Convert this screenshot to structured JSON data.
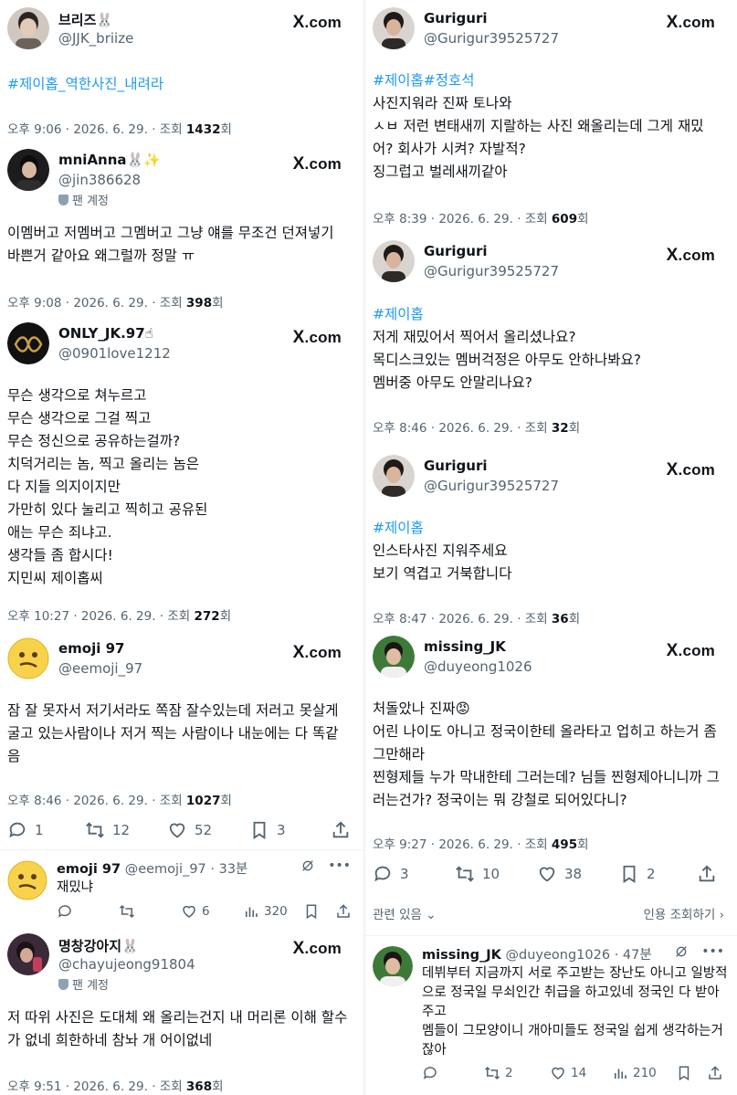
{
  "brand": {
    "x_label": "X",
    "com_label": ".com"
  },
  "left": {
    "t1": {
      "name": "브리즈🐰",
      "handle": "@JJK_briize",
      "hashtag": "#제이홉_역한사진_내려라",
      "meta_pre": "오후 9:06 · 2026. 6. 29. · 조회 ",
      "views": "1432",
      "meta_post": "회"
    },
    "t2": {
      "name": "mniAnna🐰✨",
      "handle": "@jin386628",
      "fan": "팬 계정",
      "text": "이멤버고 저멤버고 그멤버고 그냥 얘를 무조건 던져넣기 바쁜거 같아요 왜그럴까 정말 ㅠ",
      "meta_pre": "오후 9:08 · 2026. 6. 29. · 조회 ",
      "views": "398",
      "meta_post": "회"
    },
    "t3": {
      "name": "ONLY_JK.97☝",
      "handle": "@0901love1212",
      "text": "무슨 생각으로 쳐누르고\n무슨 생각으로 그걸 찍고\n무슨 정신으로 공유하는걸까?\n치덕거리는 놈, 찍고 올리는 놈은\n다 지들 의지이지만\n가만히 있다 눌리고 찍히고 공유된\n애는 무슨 죄냐고.\n생각들 좀 합시다!\n지민씨 제이홉씨",
      "meta_pre": "오후 10:27 · 2026. 6. 29. · 조회 ",
      "views": "272",
      "meta_post": "회"
    },
    "t4": {
      "name": "emoji 97",
      "handle": "@eemoji_97",
      "text": "잠 잘 못자서 저기서라도 쪽잠 잘수있는데 저러고 못살게 굴고 있는사람이나 저거 찍는 사람이나 내눈에는 다 똑같음",
      "meta_pre": "오후 8:46 · 2026. 6. 29. · 조회 ",
      "views": "1027",
      "meta_post": "회",
      "replies": "1",
      "reposts": "12",
      "likes": "52",
      "bookmarks": "3"
    },
    "r1": {
      "name": "emoji 97",
      "sub": "@eemoji_97 · 33분",
      "text": "재밌냐",
      "reposts": "",
      "likes": "6",
      "views": "320"
    },
    "t5": {
      "name": "명창강아지🐰",
      "handle": "@chayujeong91804",
      "fan": "팬 계정",
      "text": "저 따위 사진은 도대체 왜 올리는건지 내 머리론 이해 할수가 없네 희한하네  참놔 개 어이없네",
      "meta_pre": "오후 9:51 · 2026. 6. 29. · 조회 ",
      "views": "368",
      "meta_post": "회"
    }
  },
  "right": {
    "t1": {
      "name": "Guriguri",
      "handle": "@Gurigur39525727",
      "hashtag": "#제이홉#정호석",
      "text": "사진지워라 진짜 토나와\nㅅㅂ 저런 변태새끼 지랄하는 사진 왜올리는데 그게 재밌어? 회사가 시켜? 자발적?\n징그럽고 벌레새끼같아",
      "meta_pre": "오후 8:39 · 2026. 6. 29. · 조회 ",
      "views": "609",
      "meta_post": "회"
    },
    "t2": {
      "name": "Guriguri",
      "handle": "@Gurigur39525727",
      "hashtag": "#제이홉",
      "text": "저게 재밌어서 찍어서 올리셨나요?\n목디스크있는 멤버걱정은 아무도 안하나봐요?\n멤버중 아무도 안말리나요?",
      "meta_pre": "오후 8:46 · 2026. 6. 29. · 조회 ",
      "views": "32",
      "meta_post": "회"
    },
    "t3": {
      "name": "Guriguri",
      "handle": "@Gurigur39525727",
      "hashtag": "#제이홉",
      "text": "인스타사진 지워주세요\n보기 역겹고 거북합니다",
      "meta_pre": "오후 8:47 · 2026. 6. 29. · 조회 ",
      "views": "36",
      "meta_post": "회"
    },
    "t4": {
      "name": "missing_JK",
      "handle": "@duyeong1026",
      "text": "처돌았나 진짜😡\n어린 나이도 아니고 정국이한테 올라타고 업히고 하는거 좀 그만해라\n찐형제들 누가 막내한테 그러는데? 님들 찐형제아니니까 그러는건가? 정국이는 뭐 강철로 되어있다니?",
      "meta_pre": "오후 9:27 · 2026. 6. 29. · 조회 ",
      "views": "495",
      "meta_post": "회",
      "replies": "3",
      "reposts": "10",
      "likes": "38",
      "bookmarks": "2",
      "related": "관련 있음",
      "quotes": "인용 조회하기"
    },
    "r1": {
      "name": "missing_JK",
      "sub": "@duyeong1026 · 47분",
      "text": "데뷔부터 지금까지 서로 주고받는 장난도 아니고 일방적으로 정국일 무쇠인간 취급을  하고있네 정국인 다 받아주고\n 멤들이 그모양이니 개아미들도 정국일 쉽게 생각하는거잖아",
      "reposts": "2",
      "likes": "14",
      "views": "210"
    }
  },
  "colors": {
    "hashtag": "#1d9bf0",
    "muted": "#536471",
    "text": "#0f1419"
  }
}
